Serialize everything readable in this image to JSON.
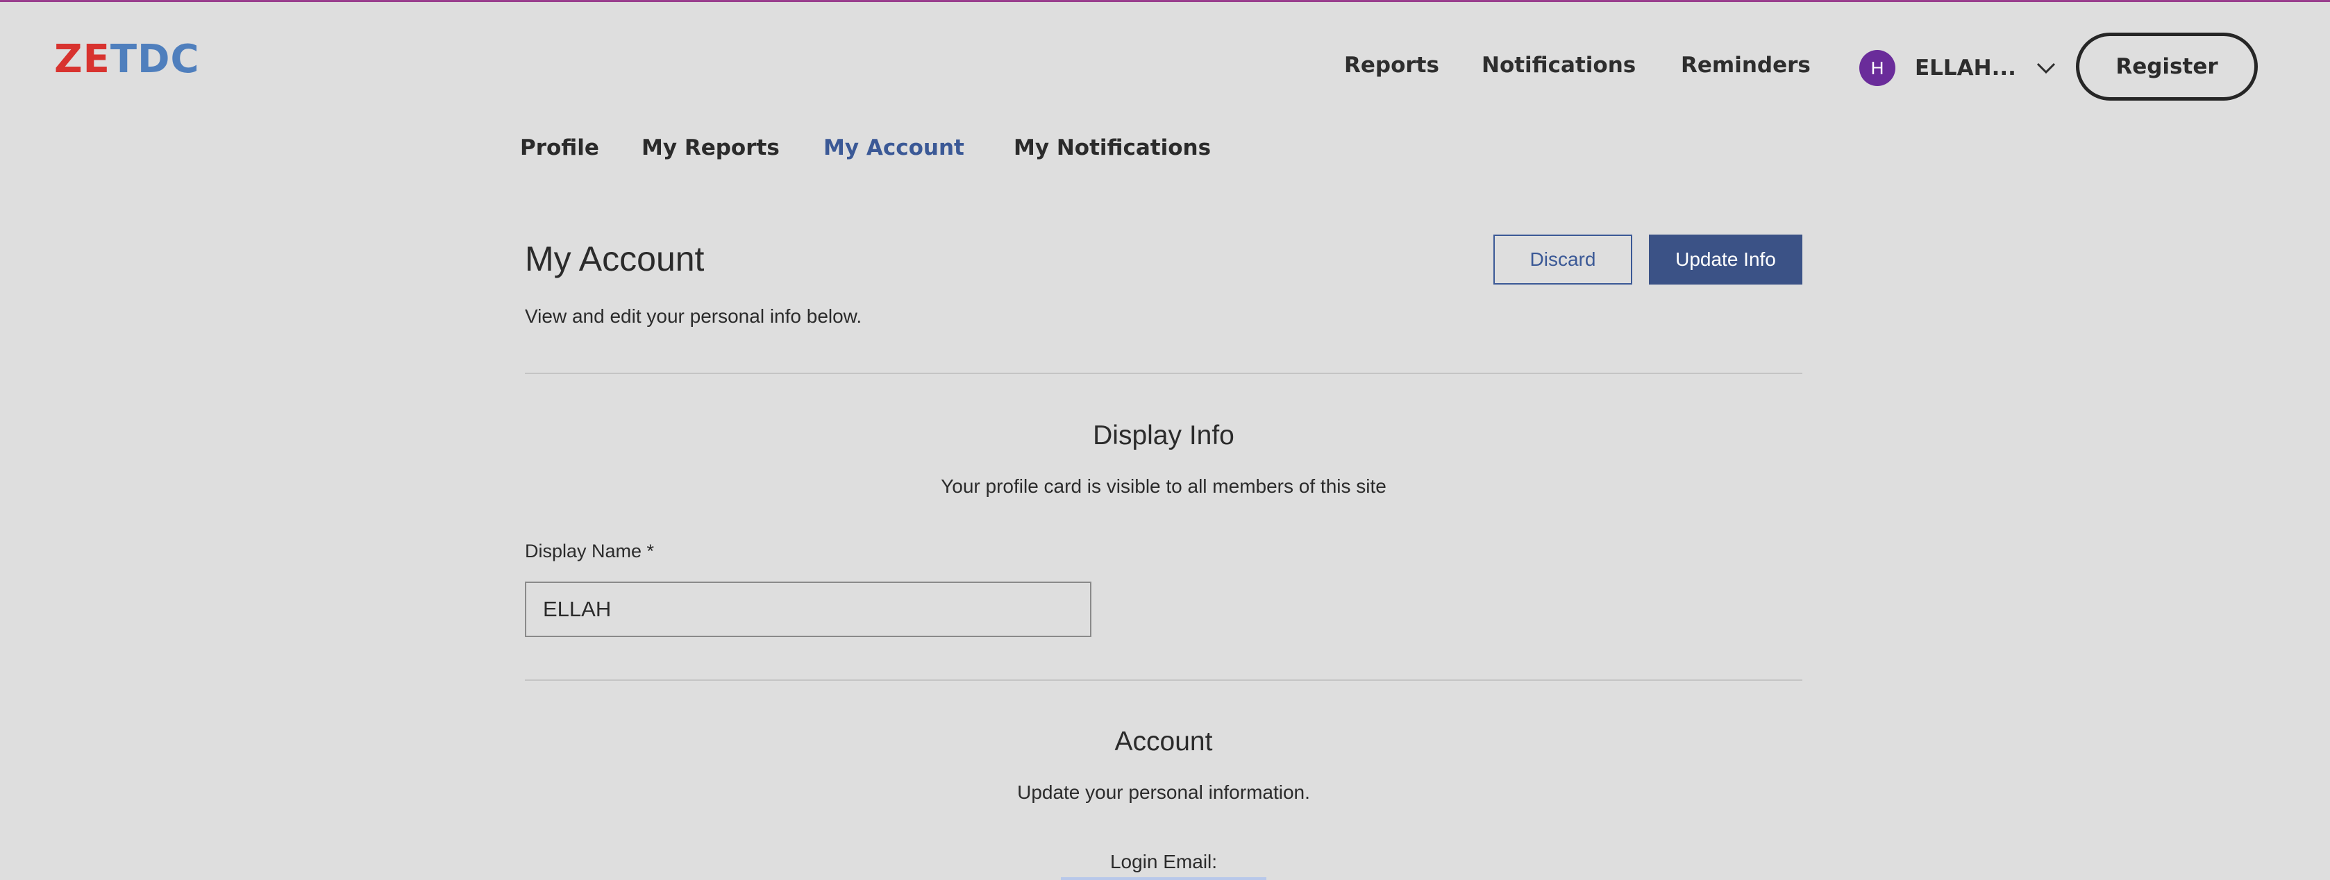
{
  "brand": {
    "logo_part1": "ZE",
    "logo_part2": "TDC",
    "colors": {
      "red": "#d8332f",
      "blue": "#4f7fbd",
      "accent": "#3b5996",
      "avatar": "#6a2c9a"
    }
  },
  "header": {
    "nav": [
      {
        "label": "Reports"
      },
      {
        "label": "Notifications"
      },
      {
        "label": "Reminders"
      }
    ],
    "user": {
      "avatar_initial": "H",
      "name": "ELLAH...",
      "dropdown_icon": "chevron-down-icon"
    },
    "register_label": "Register"
  },
  "tabs": [
    {
      "label": "Profile",
      "active": false
    },
    {
      "label": "My Reports",
      "active": false
    },
    {
      "label": "My Account",
      "active": true
    },
    {
      "label": "My Notifications",
      "active": false
    }
  ],
  "page": {
    "title": "My Account",
    "subtitle": "View and edit your personal info below.",
    "discard_label": "Discard",
    "update_label": "Update Info"
  },
  "display_info": {
    "title": "Display Info",
    "description": "Your profile card is visible to all members of this site",
    "display_name_label": "Display Name *",
    "display_name_value": "ELLAH"
  },
  "account": {
    "title": "Account",
    "description": "Update your personal information.",
    "login_email_label": "Login Email:"
  }
}
